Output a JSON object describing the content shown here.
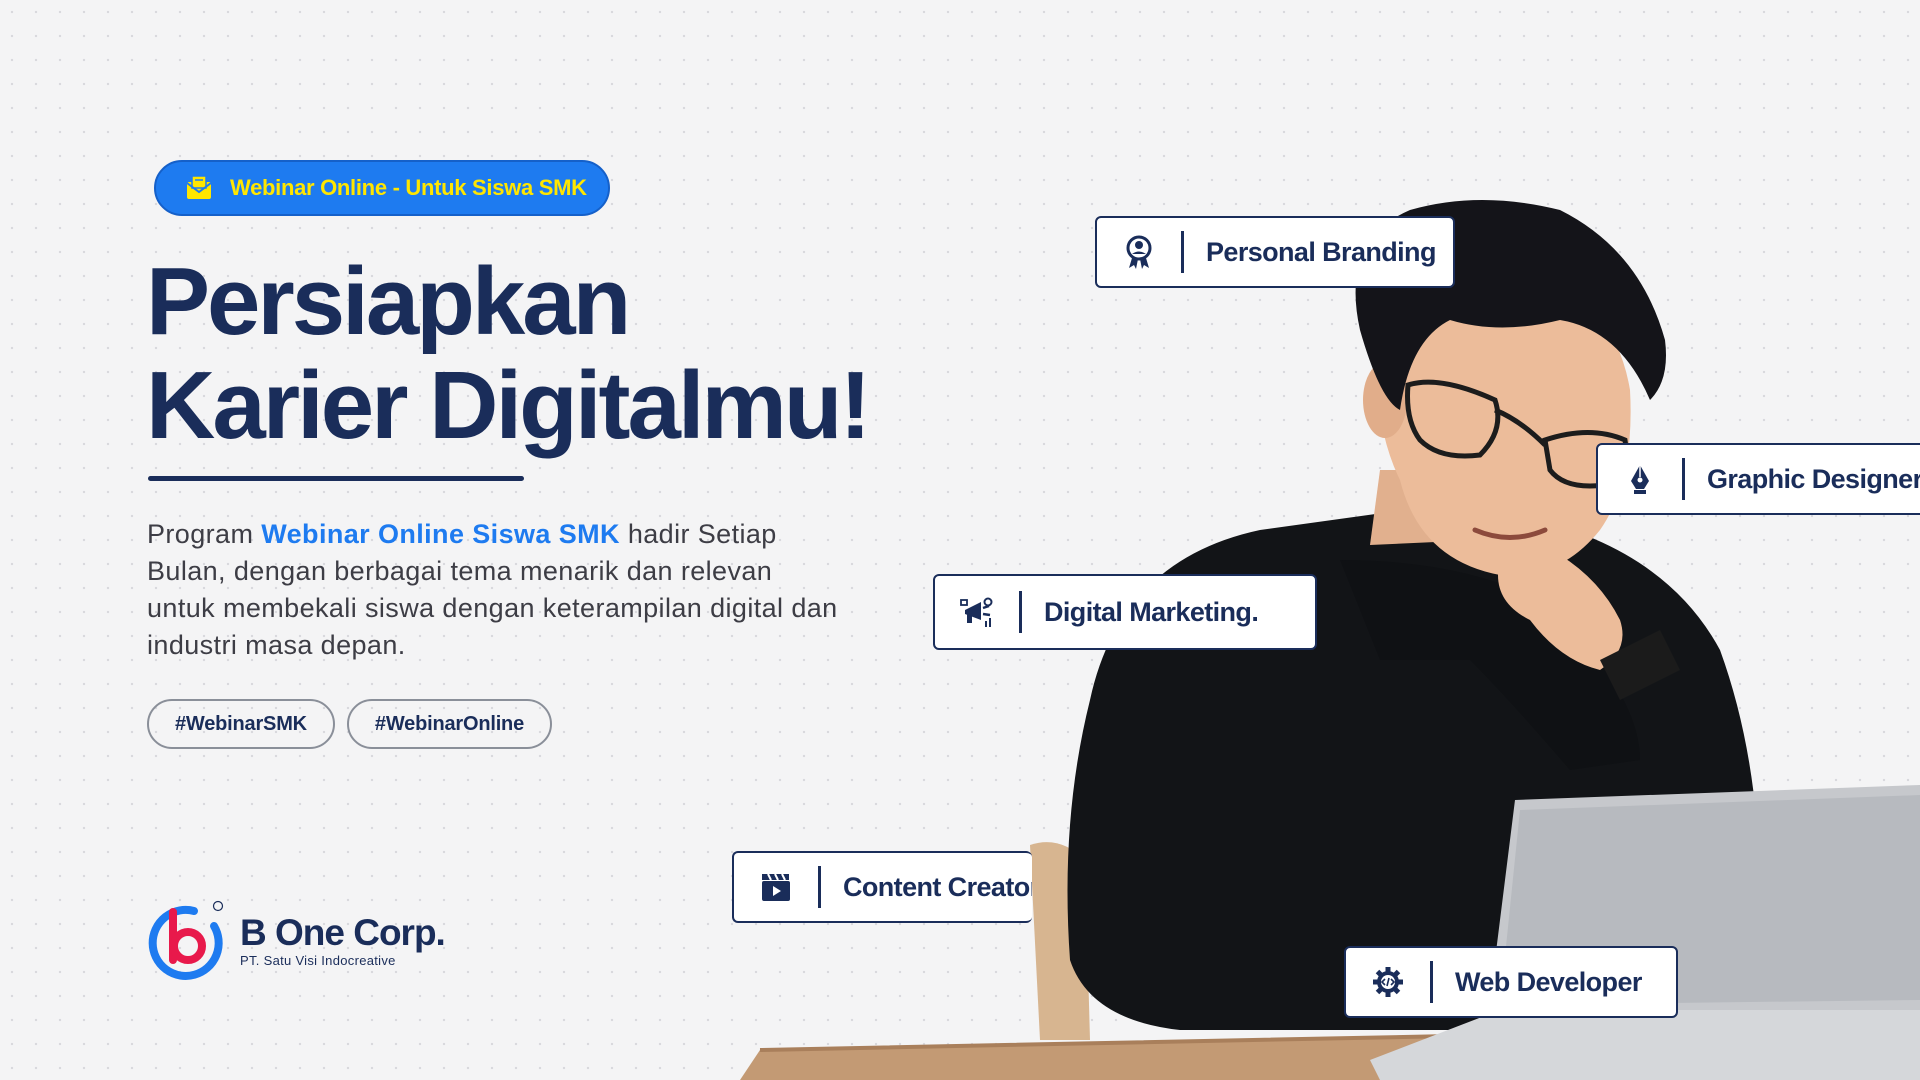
{
  "badge": {
    "text": "Webinar Online - Untuk Siswa SMK",
    "icon": "mail-icon",
    "bg": "#1e7bf0",
    "text_color": "#ffe600"
  },
  "headline": {
    "line1": "Persiapkan",
    "line2": "Karier Digitalmu!"
  },
  "description": {
    "prefix": "Program ",
    "highlight": "Webinar Online Siswa SMK",
    "suffix": " hadir Setiap Bulan, dengan berbagai tema menarik dan relevan untuk membekali siswa dengan keterampilan digital dan industri masa depan."
  },
  "hashtags": [
    "#WebinarSMK",
    "#WebinarOnline"
  ],
  "logo": {
    "name": "B One Corp.",
    "tagline": "PT. Satu Visi Indocreative",
    "registered": "®"
  },
  "topics": [
    {
      "label": "Personal Branding",
      "icon": "award-badge-icon"
    },
    {
      "label": "Graphic Designer",
      "icon": "pen-tool-icon"
    },
    {
      "label": "Digital Marketing.",
      "icon": "megaphone-icon"
    },
    {
      "label": "Content Creator",
      "icon": "clapperboard-icon"
    },
    {
      "label": "Web Developer",
      "icon": "code-gear-icon"
    }
  ],
  "colors": {
    "navy": "#1a2d5a",
    "blue": "#1e7bf0",
    "yellow": "#ffe600",
    "logo_red": "#e8194b"
  }
}
